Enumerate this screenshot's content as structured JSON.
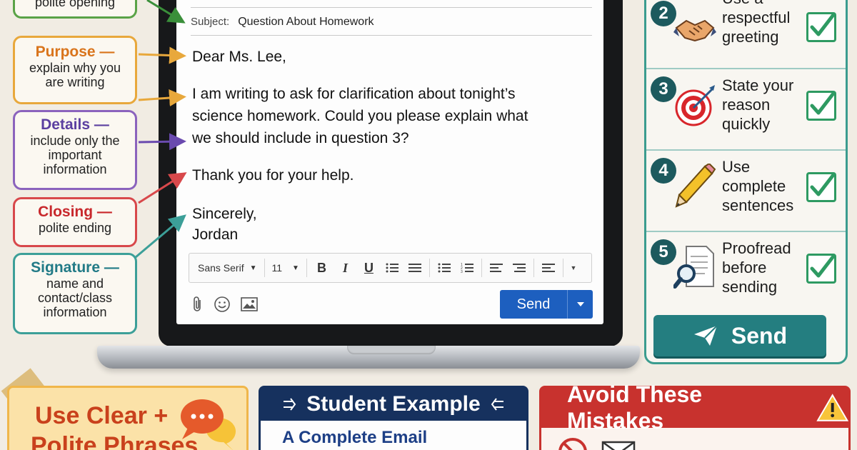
{
  "callouts": {
    "opening": {
      "desc": "polite opening"
    },
    "purpose": {
      "title": "Purpose —",
      "desc": "explain why you are writing"
    },
    "details": {
      "title": "Details —",
      "desc": "include only the important information"
    },
    "closing": {
      "title": "Closing —",
      "desc": "polite ending"
    },
    "signature": {
      "title": "Signature —",
      "desc": "name and contact/class information"
    }
  },
  "email": {
    "subject_label": "Subject:",
    "subject": "Question About Homework",
    "greeting": "Dear Ms. Lee,",
    "body_lines": [
      "I am writing to ask for clarification about tonight’s",
      "science homework. Could you please explain what",
      "we should include in question 3?"
    ],
    "thanks": "Thank you for your help.",
    "signoff": "Sincerely,",
    "name": "Jordan",
    "toolbar": {
      "font": "Sans Serif",
      "size": "11",
      "bold": "B",
      "italic": "I",
      "underline": "U"
    },
    "send_label": "Send"
  },
  "checklist": {
    "steps": [
      {
        "num": "2",
        "text": "Use a respectful greeting",
        "icon": "handshake-icon"
      },
      {
        "num": "3",
        "text": "State your reason quickly",
        "icon": "target-icon"
      },
      {
        "num": "4",
        "text": "Use complete sentences",
        "icon": "pencil-icon"
      },
      {
        "num": "5",
        "text": "Proofread before sending",
        "icon": "magnifier-document-icon"
      }
    ],
    "send_label": "Send"
  },
  "bottom": {
    "phrases_line1": "Use Clear +",
    "phrases_line2": "Polite Phrases",
    "example_title": "Student Example",
    "example_subtitle": "A Complete Email",
    "mistakes_title": "Avoid These Mistakes"
  },
  "colors": {
    "accent_teal": "#247e80",
    "send_blue": "#1d5fbf",
    "mistakes_red": "#c8322e",
    "example_navy": "#16315e",
    "check_green": "#2e9a62"
  }
}
